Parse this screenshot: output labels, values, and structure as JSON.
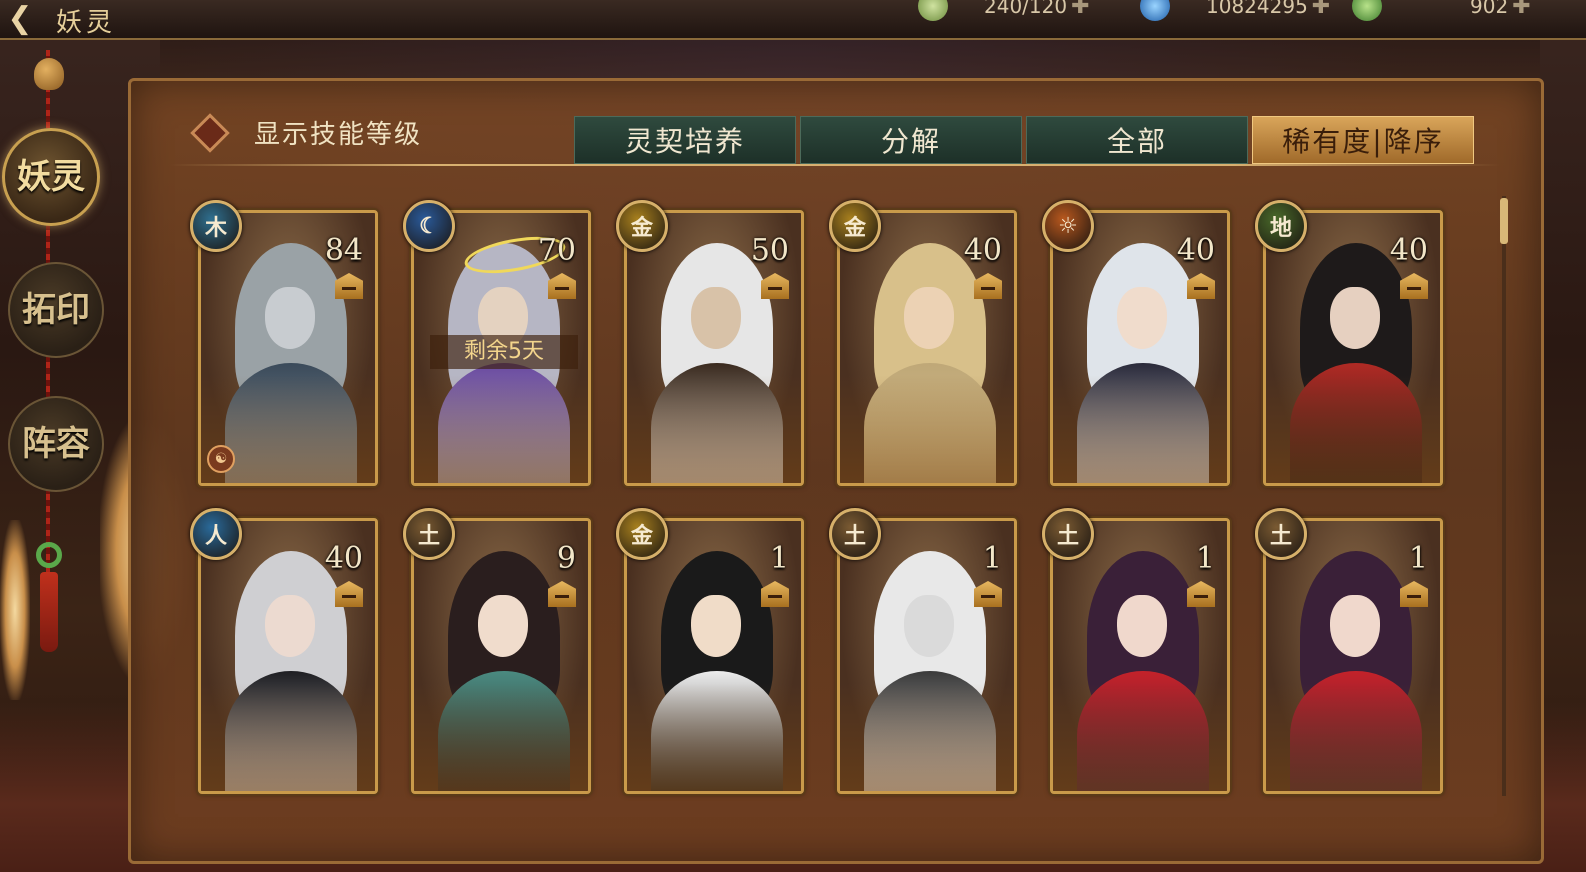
{
  "header": {
    "back_icon": "back-arrow-icon",
    "title": "妖灵",
    "resources": [
      {
        "name": "stamina",
        "icon": "jade-stamina-icon",
        "value": "240/120",
        "color": "#8bb36a"
      },
      {
        "name": "gem",
        "icon": "blue-gem-icon",
        "value": "10824295",
        "color": "#3a8ad6"
      },
      {
        "name": "coin",
        "icon": "green-coin-icon",
        "value": "902",
        "color": "#6ab34a"
      }
    ]
  },
  "sidebar": {
    "items": [
      {
        "label": "妖灵",
        "active": true
      },
      {
        "label": "拓印",
        "active": false
      },
      {
        "label": "阵容",
        "active": false
      }
    ]
  },
  "toolbar": {
    "toggle_label": "显示技能等级",
    "tabs": [
      "灵契培养",
      "分解",
      "全部",
      "稀有度|降序"
    ]
  },
  "cards": [
    {
      "element": "木",
      "element_color": "#2f6f8f",
      "level": "84",
      "palette": [
        "#9aa2a6",
        "#c8ccd0",
        "#3a4a5a"
      ],
      "bond": true
    },
    {
      "element": "☾",
      "element_color": "#2a5a9a",
      "level": "70",
      "palette": [
        "#b6b6c4",
        "#e4d2c0",
        "#6a4aa0"
      ],
      "remaining": "剩余5天",
      "halo": true
    },
    {
      "element": "金",
      "element_color": "#a8801e",
      "level": "50",
      "palette": [
        "#e6e6e6",
        "#d8c2a8",
        "#3a2a1e"
      ]
    },
    {
      "element": "金",
      "element_color": "#a8801e",
      "level": "40",
      "palette": [
        "#d8c08a",
        "#ecd2b4",
        "#bfa878"
      ]
    },
    {
      "element": "☼",
      "element_color": "#b8581e",
      "level": "40",
      "palette": [
        "#dfe4ea",
        "#f0dccc",
        "#2a2a3a"
      ]
    },
    {
      "element": "地",
      "element_color": "#4a6a2a",
      "level": "40",
      "palette": [
        "#1e1a1a",
        "#e6d0c0",
        "#b02a24"
      ]
    },
    {
      "element": "人",
      "element_color": "#2a6a9a",
      "level": "40",
      "palette": [
        "#cfcfd2",
        "#ecdad0",
        "#1e1e22"
      ]
    },
    {
      "element": "土",
      "element_color": "#7a5a32",
      "level": "9",
      "palette": [
        "#2a1e1e",
        "#f0dccc",
        "#4a8a80"
      ]
    },
    {
      "element": "金",
      "element_color": "#a8801e",
      "level": "1",
      "palette": [
        "#1a1a1a",
        "#f0dcc8",
        "#ececec"
      ]
    },
    {
      "element": "土",
      "element_color": "#7a5a32",
      "level": "1",
      "palette": [
        "#e8e8e8",
        "#dadada",
        "#3a3a3a"
      ]
    },
    {
      "element": "土",
      "element_color": "#7a5a32",
      "level": "1",
      "palette": [
        "#3a2038",
        "#f0d8cc",
        "#c4222a"
      ]
    },
    {
      "element": "土",
      "element_color": "#7a5a32",
      "level": "1",
      "palette": [
        "#3a2038",
        "#f0d8cc",
        "#c4222a"
      ]
    }
  ]
}
